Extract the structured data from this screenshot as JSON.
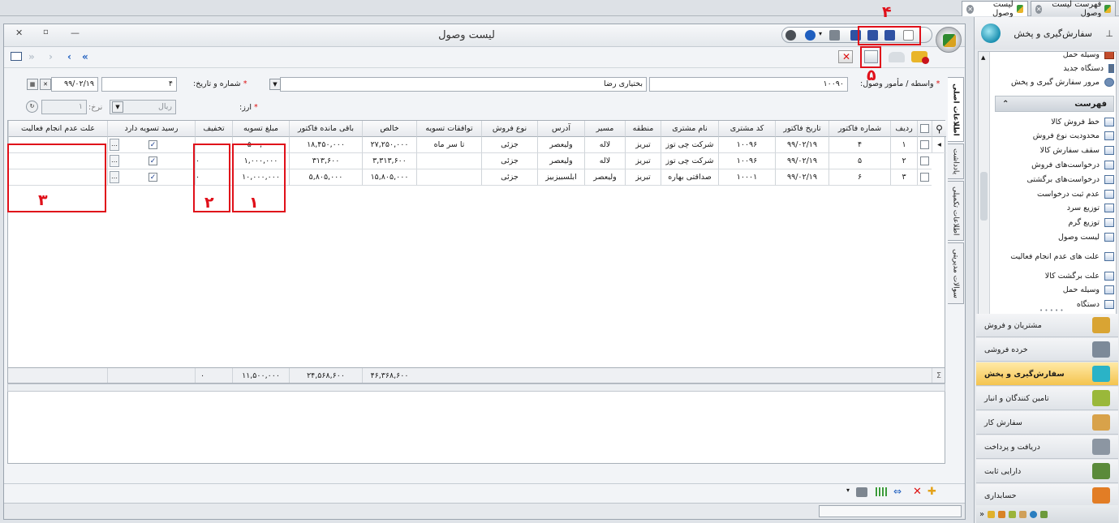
{
  "doc_tabs": [
    {
      "label": "لیست وصول",
      "active": true
    },
    {
      "label": "فهرست لیست وصول",
      "active": false
    }
  ],
  "window": {
    "title": "لیست وصول",
    "minimize": "—",
    "restore": "▫",
    "close": "✕"
  },
  "form": {
    "agent_label": "واسطه / مأمور وصول:",
    "agent_code": "۱۰۰۹۰",
    "agent_name": "بختیاری رضا",
    "number_date_label": "شماره و تاریخ:",
    "number": "۴",
    "date": "۹۹/۰۲/۱۹",
    "currency_label": "ارز:",
    "currency_value": "ریال",
    "rate_label": "نرخ:",
    "rate_value": "۱"
  },
  "grid": {
    "columns": [
      "ردیف",
      "شماره فاکتور",
      "تاریخ فاکتور",
      "کد مشتری",
      "نام مشتری",
      "منطقه",
      "مسیر",
      "آدرس",
      "نوع فروش",
      "توافقات تسویه",
      "خالص",
      "باقی مانده فاکتور",
      "مبلغ تسویه",
      "تخفیف",
      "رسید تسویه دارد",
      "علت عدم انجام فعالیت"
    ],
    "rows": [
      {
        "radif": "۱",
        "invoice_no": "۴",
        "invoice_date": "۹۹/۰۲/۱۹",
        "customer_code": "۱۰۰۹۶",
        "customer_name": "شرکت چی توز",
        "region": "تبریز",
        "route": "لاله",
        "address": "ولیعصر",
        "sale_type": "جزئی",
        "settlement": "تا سر ماه",
        "net": "۲۷,۲۵۰,۰۰۰",
        "remaining": "۱۸,۴۵۰,۰۰۰",
        "settle_amount": "۵۰۰,۰۰۰",
        "discount": "۰",
        "receipt": true,
        "reason": ""
      },
      {
        "radif": "۲",
        "invoice_no": "۵",
        "invoice_date": "۹۹/۰۲/۱۹",
        "customer_code": "۱۰۰۹۶",
        "customer_name": "شرکت چی توز",
        "region": "تبریز",
        "route": "لاله",
        "address": "ولیعصر",
        "sale_type": "جزئی",
        "settlement": "",
        "net": "۳,۳۱۳,۶۰۰",
        "remaining": "۳۱۳,۶۰۰",
        "settle_amount": "۱,۰۰۰,۰۰۰",
        "discount": "۰",
        "receipt": true,
        "reason": ""
      },
      {
        "radif": "۳",
        "invoice_no": "۶",
        "invoice_date": "۹۹/۰۲/۱۹",
        "customer_code": "۱۰۰۰۱",
        "customer_name": "صداقتی بهاره",
        "region": "تبریز",
        "route": "ولیعصر",
        "address": "ابلسبیزبیز",
        "sale_type": "جزئی",
        "settlement": "",
        "net": "۱۵,۸۰۵,۰۰۰",
        "remaining": "۵,۸۰۵,۰۰۰",
        "settle_amount": "۱۰,۰۰۰,۰۰۰",
        "discount": "۰",
        "receipt": true,
        "reason": ""
      }
    ],
    "totals": {
      "net": "۴۶,۳۶۸,۶۰۰",
      "remaining": "۲۴,۵۶۸,۶۰۰",
      "settle_amount": "۱۱,۵۰۰,۰۰۰",
      "discount": "۰"
    },
    "sum_symbol": "Σ"
  },
  "side_tabs": [
    "اطلاعات اصلی",
    "یادداشت",
    "اطلاعات تکمیلی",
    "سوالات مدیریتی"
  ],
  "nav_pane": {
    "title": "سفارش‌گیری و پخش",
    "top_items": [
      "وسیله حمل",
      "دستگاه جدید",
      "مرور سفارش گیری و پخش"
    ],
    "section_title": "فهرست",
    "list_items": [
      "خط فروش کالا",
      "محدودیت نوع فروش",
      "سقف سفارش کالا",
      "درخواست‌های فروش",
      "درخواست‌های برگشتی",
      "عدم ثبت درخواست",
      "توزیع سرد",
      "توزیع گرم",
      "لیست وصول",
      "علت های عدم انجام فعالیت",
      "علت برگشت کالا",
      "وسیله حمل",
      "دستگاه"
    ],
    "modules": [
      "مشتریان و فروش",
      "خرده فروشی",
      "سفارش‌گیری و پخش",
      "تامین کنندگان و انبار",
      "سفارش کار",
      "دریافت و پرداخت",
      "دارایی ثابت",
      "حسابداری"
    ],
    "active_module": "سفارش‌گیری و پخش"
  },
  "annotations": [
    "۱",
    "۲",
    "۳",
    "۴",
    "۵"
  ],
  "colors": {
    "annotation": "#e0101a",
    "active_module": "#f4c44f"
  },
  "icons": {
    "nav_first": "»",
    "nav_prev": "›",
    "nav_next": "‹",
    "nav_last": "«"
  }
}
